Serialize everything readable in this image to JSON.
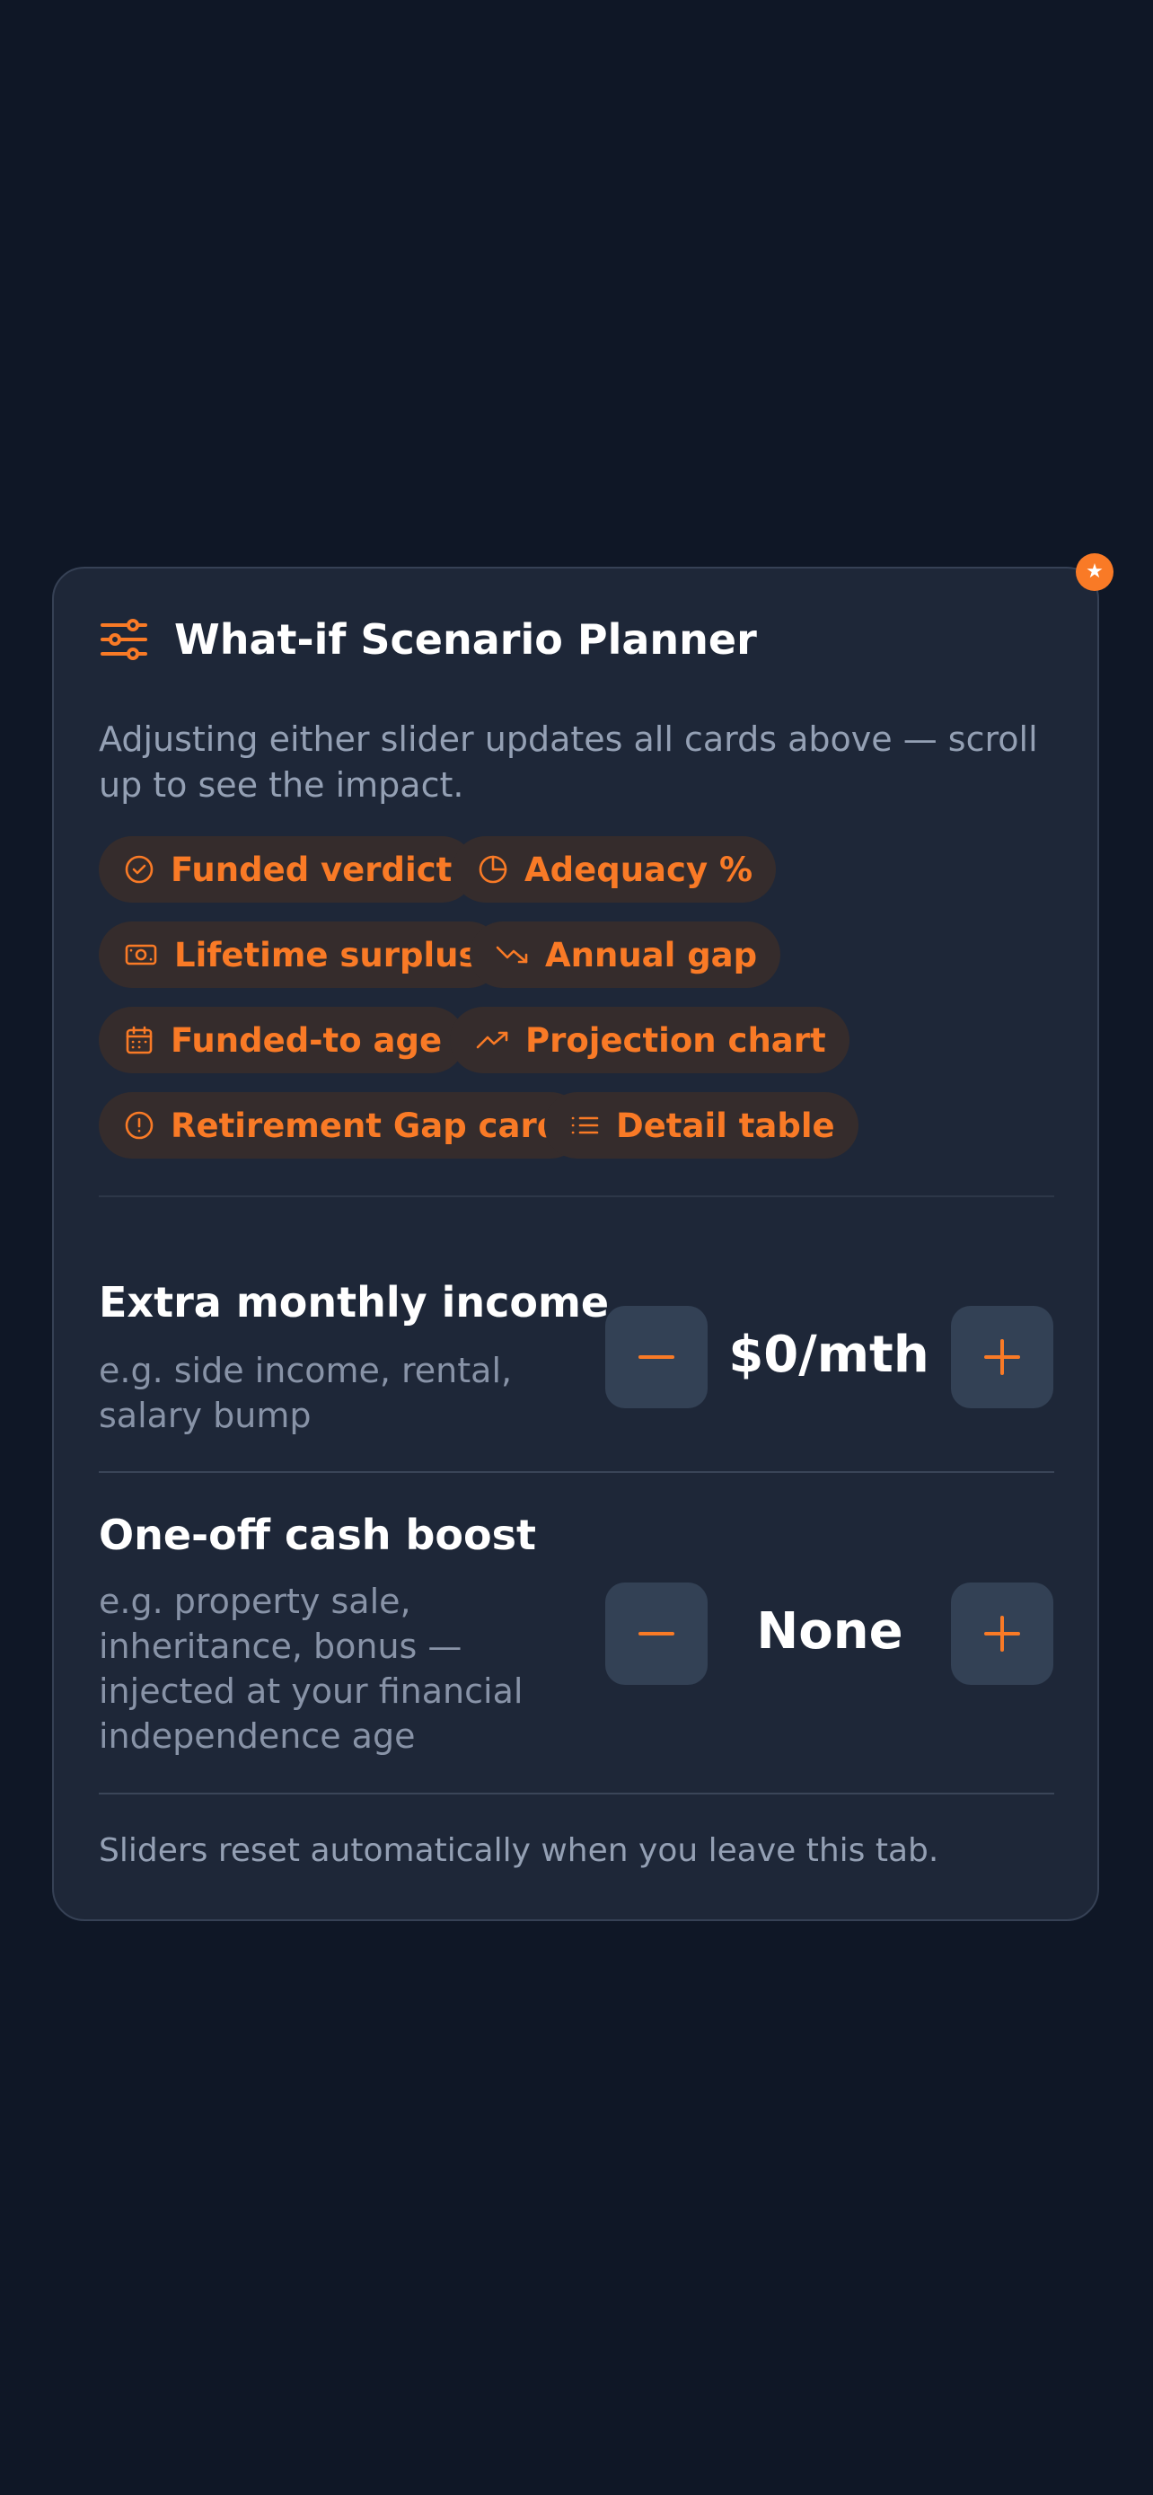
{
  "planner": {
    "title": "What-if Scenario Planner",
    "description": "Adjusting either slider updates all cards above — scroll up to see the impact.",
    "badge_icon": "★",
    "chips": [
      {
        "label": "Funded verdict",
        "icon": "check-circle-icon"
      },
      {
        "label": "Adequacy %",
        "icon": "pie-chart-icon"
      },
      {
        "label": "Lifetime surplus",
        "icon": "banknote-icon"
      },
      {
        "label": "Annual gap",
        "icon": "trending-down-icon"
      },
      {
        "label": "Funded-to age",
        "icon": "calendar-icon"
      },
      {
        "label": "Projection chart",
        "icon": "trending-up-icon"
      },
      {
        "label": "Retirement Gap card",
        "icon": "alert-circle-icon"
      },
      {
        "label": "Detail table",
        "icon": "list-icon"
      }
    ],
    "extra_income": {
      "title": "Extra monthly income",
      "subtitle": "e.g. side income, rental, salary bump",
      "value": "$0/mth"
    },
    "cash_boost": {
      "title": "One-off cash boost",
      "subtitle": "e.g. property sale, inheritance, bonus — injected at your financial independence age",
      "value": "None"
    },
    "footer": "Sliders reset automatically when you leave this tab."
  },
  "colors": {
    "background": "#0f1726",
    "card": "#1e2738",
    "accent": "#f97a26",
    "chip_bg": "#352c2c",
    "button_bg": "#334155"
  }
}
